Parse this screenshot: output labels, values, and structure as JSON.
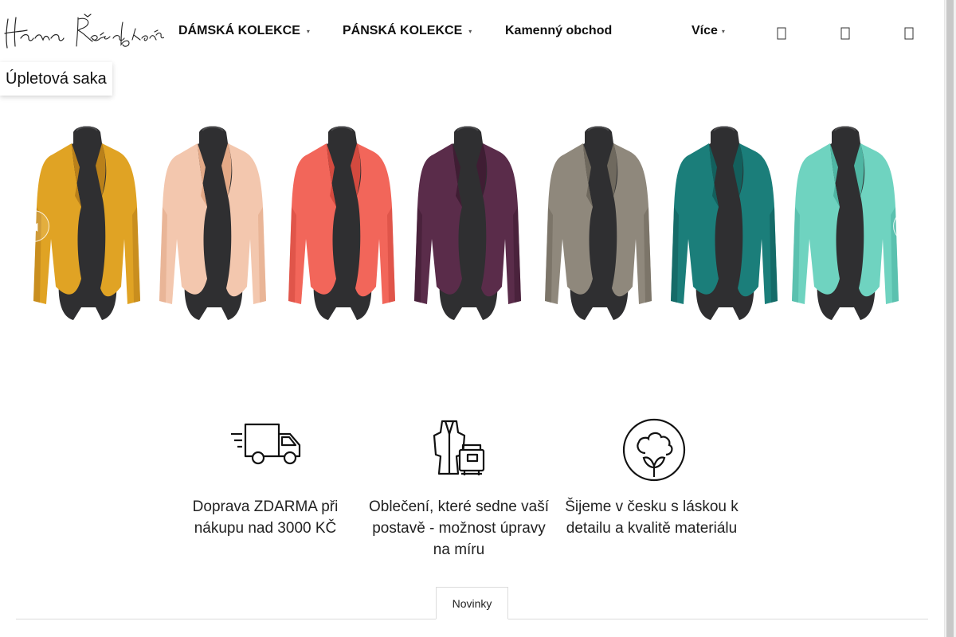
{
  "header": {
    "logo_text": "Hana Řežábková",
    "nav": [
      {
        "label": "DÁMSKÁ KOLEKCE",
        "caret": "▾"
      },
      {
        "label": "PÁNSKÁ KOLEKCE",
        "caret": "▾"
      },
      {
        "label": "Kamenný obchod"
      },
      {
        "label": "Více",
        "caret": "▾"
      }
    ],
    "icons": [
      "search-icon",
      "user-icon",
      "cart-icon"
    ]
  },
  "category": {
    "label": "Úpletová saka"
  },
  "carousel": {
    "prev_icon": "chevron-left-icon",
    "next_icon": "chevron-right-icon",
    "items": [
      {
        "name": "jacket-mustard",
        "color": "#e0a324",
        "shade": "#b9801a"
      },
      {
        "name": "jacket-peach",
        "color": "#f3c7ae",
        "shade": "#e3a987"
      },
      {
        "name": "jacket-coral",
        "color": "#f2665a",
        "shade": "#d44a3f"
      },
      {
        "name": "jacket-plum",
        "color": "#5a2c4a",
        "shade": "#3f1d33"
      },
      {
        "name": "jacket-taupe",
        "color": "#8f887c",
        "shade": "#6f695e"
      },
      {
        "name": "jacket-teal",
        "color": "#1b7e7a",
        "shade": "#135f5c"
      },
      {
        "name": "jacket-mint",
        "color": "#6fd3c0",
        "shade": "#4fb6a3"
      }
    ]
  },
  "features": [
    {
      "icon": "truck-icon",
      "text": "Doprava ZDARMA při nákupu nad 3000 KČ"
    },
    {
      "icon": "sewing-icon",
      "text": "Oblečení, které sedne vaší postavě - možnost úpravy na míru"
    },
    {
      "icon": "cotton-icon",
      "text": "Šijeme v česku s láskou k detailu a kvalitě materiálu"
    }
  ],
  "tabs": [
    {
      "label": "Novinky"
    }
  ]
}
